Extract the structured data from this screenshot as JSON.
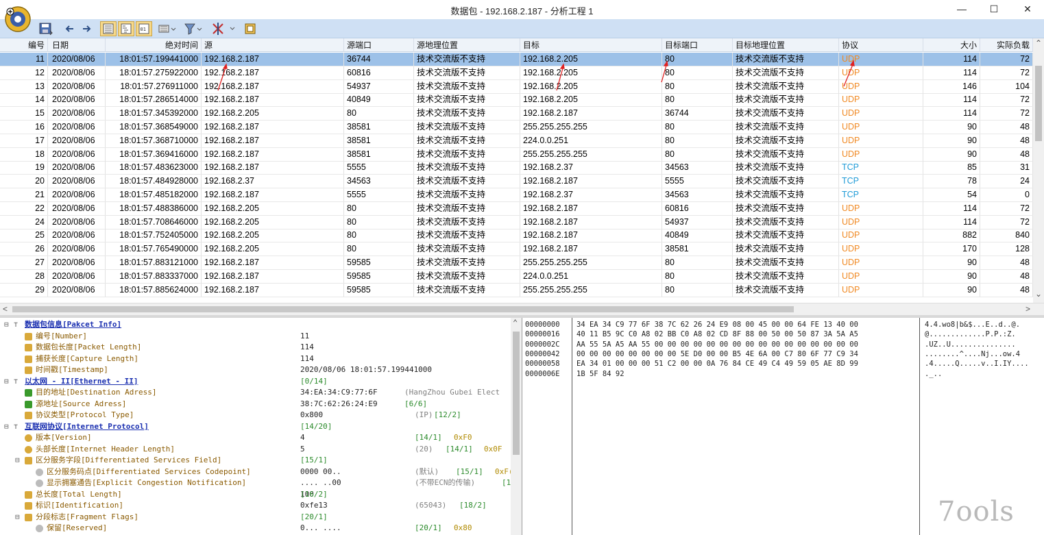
{
  "window": {
    "title": "数据包 - 192.168.2.187 - 分析工程 1",
    "minimize": "—",
    "maximize": "☐",
    "close": "✕"
  },
  "toolbar": {
    "icons": [
      "save-icon",
      "back-icon",
      "forward-icon",
      "view-list-icon",
      "view-detail-icon",
      "view-hex-icon",
      "filter-icon",
      "funnel-icon",
      "tools-icon",
      "export-icon"
    ]
  },
  "columns": [
    "编号",
    "日期",
    "绝对时间",
    "源",
    "源端口",
    "源地理位置",
    "目标",
    "目标端口",
    "目标地理位置",
    "协议",
    "大小",
    "实际负载"
  ],
  "packets": [
    {
      "no": "11",
      "date": "2020/08/06",
      "time": "18:01:57.199441000",
      "src": "192.168.2.187",
      "sport": "36744",
      "sgeo": "技术交流版不支持",
      "dst": "192.168.2.205",
      "dport": "80",
      "dgeo": "技术交流版不支持",
      "proto": "UDP",
      "size": "114",
      "payload": "72",
      "selected": true
    },
    {
      "no": "12",
      "date": "2020/08/06",
      "time": "18:01:57.275922000",
      "src": "192.168.2.187",
      "sport": "60816",
      "sgeo": "技术交流版不支持",
      "dst": "192.168.2.205",
      "dport": "80",
      "dgeo": "技术交流版不支持",
      "proto": "UDP",
      "size": "114",
      "payload": "72"
    },
    {
      "no": "13",
      "date": "2020/08/06",
      "time": "18:01:57.276911000",
      "src": "192.168.2.187",
      "sport": "54937",
      "sgeo": "技术交流版不支持",
      "dst": "192.168.2.205",
      "dport": "80",
      "dgeo": "技术交流版不支持",
      "proto": "UDP",
      "size": "146",
      "payload": "104"
    },
    {
      "no": "14",
      "date": "2020/08/06",
      "time": "18:01:57.286514000",
      "src": "192.168.2.187",
      "sport": "40849",
      "sgeo": "技术交流版不支持",
      "dst": "192.168.2.205",
      "dport": "80",
      "dgeo": "技术交流版不支持",
      "proto": "UDP",
      "size": "114",
      "payload": "72"
    },
    {
      "no": "15",
      "date": "2020/08/06",
      "time": "18:01:57.345392000",
      "src": "192.168.2.205",
      "sport": "80",
      "sgeo": "技术交流版不支持",
      "dst": "192.168.2.187",
      "dport": "36744",
      "dgeo": "技术交流版不支持",
      "proto": "UDP",
      "size": "114",
      "payload": "72"
    },
    {
      "no": "16",
      "date": "2020/08/06",
      "time": "18:01:57.368549000",
      "src": "192.168.2.187",
      "sport": "38581",
      "sgeo": "技术交流版不支持",
      "dst": "255.255.255.255",
      "dport": "80",
      "dgeo": "技术交流版不支持",
      "proto": "UDP",
      "size": "90",
      "payload": "48"
    },
    {
      "no": "17",
      "date": "2020/08/06",
      "time": "18:01:57.368710000",
      "src": "192.168.2.187",
      "sport": "38581",
      "sgeo": "技术交流版不支持",
      "dst": "224.0.0.251",
      "dport": "80",
      "dgeo": "技术交流版不支持",
      "proto": "UDP",
      "size": "90",
      "payload": "48"
    },
    {
      "no": "18",
      "date": "2020/08/06",
      "time": "18:01:57.369416000",
      "src": "192.168.2.187",
      "sport": "38581",
      "sgeo": "技术交流版不支持",
      "dst": "255.255.255.255",
      "dport": "80",
      "dgeo": "技术交流版不支持",
      "proto": "UDP",
      "size": "90",
      "payload": "48"
    },
    {
      "no": "19",
      "date": "2020/08/06",
      "time": "18:01:57.483623000",
      "src": "192.168.2.187",
      "sport": "5555",
      "sgeo": "技术交流版不支持",
      "dst": "192.168.2.37",
      "dport": "34563",
      "dgeo": "技术交流版不支持",
      "proto": "TCP",
      "size": "85",
      "payload": "31"
    },
    {
      "no": "20",
      "date": "2020/08/06",
      "time": "18:01:57.484928000",
      "src": "192.168.2.37",
      "sport": "34563",
      "sgeo": "技术交流版不支持",
      "dst": "192.168.2.187",
      "dport": "5555",
      "dgeo": "技术交流版不支持",
      "proto": "TCP",
      "size": "78",
      "payload": "24"
    },
    {
      "no": "21",
      "date": "2020/08/06",
      "time": "18:01:57.485182000",
      "src": "192.168.2.187",
      "sport": "5555",
      "sgeo": "技术交流版不支持",
      "dst": "192.168.2.37",
      "dport": "34563",
      "dgeo": "技术交流版不支持",
      "proto": "TCP",
      "size": "54",
      "payload": "0"
    },
    {
      "no": "22",
      "date": "2020/08/06",
      "time": "18:01:57.488386000",
      "src": "192.168.2.205",
      "sport": "80",
      "sgeo": "技术交流版不支持",
      "dst": "192.168.2.187",
      "dport": "60816",
      "dgeo": "技术交流版不支持",
      "proto": "UDP",
      "size": "114",
      "payload": "72"
    },
    {
      "no": "24",
      "date": "2020/08/06",
      "time": "18:01:57.708646000",
      "src": "192.168.2.205",
      "sport": "80",
      "sgeo": "技术交流版不支持",
      "dst": "192.168.2.187",
      "dport": "54937",
      "dgeo": "技术交流版不支持",
      "proto": "UDP",
      "size": "114",
      "payload": "72"
    },
    {
      "no": "25",
      "date": "2020/08/06",
      "time": "18:01:57.752405000",
      "src": "192.168.2.205",
      "sport": "80",
      "sgeo": "技术交流版不支持",
      "dst": "192.168.2.187",
      "dport": "40849",
      "dgeo": "技术交流版不支持",
      "proto": "UDP",
      "size": "882",
      "payload": "840"
    },
    {
      "no": "26",
      "date": "2020/08/06",
      "time": "18:01:57.765490000",
      "src": "192.168.2.205",
      "sport": "80",
      "sgeo": "技术交流版不支持",
      "dst": "192.168.2.187",
      "dport": "38581",
      "dgeo": "技术交流版不支持",
      "proto": "UDP",
      "size": "170",
      "payload": "128"
    },
    {
      "no": "27",
      "date": "2020/08/06",
      "time": "18:01:57.883121000",
      "src": "192.168.2.187",
      "sport": "59585",
      "sgeo": "技术交流版不支持",
      "dst": "255.255.255.255",
      "dport": "80",
      "dgeo": "技术交流版不支持",
      "proto": "UDP",
      "size": "90",
      "payload": "48"
    },
    {
      "no": "28",
      "date": "2020/08/06",
      "time": "18:01:57.883337000",
      "src": "192.168.2.187",
      "sport": "59585",
      "sgeo": "技术交流版不支持",
      "dst": "224.0.0.251",
      "dport": "80",
      "dgeo": "技术交流版不支持",
      "proto": "UDP",
      "size": "90",
      "payload": "48"
    },
    {
      "no": "29",
      "date": "2020/08/06",
      "time": "18:01:57.885624000",
      "src": "192.168.2.187",
      "sport": "59585",
      "sgeo": "技术交流版不支持",
      "dst": "255.255.255.255",
      "dport": "80",
      "dgeo": "技术交流版不支持",
      "proto": "UDP",
      "size": "90",
      "payload": "48"
    }
  ],
  "tree": [
    {
      "indent": 0,
      "sec": true,
      "label": "数据包信息[Pakcet Info]",
      "value": "",
      "ex1": "",
      "ex2": "",
      "ex3": ""
    },
    {
      "indent": 1,
      "label": "编号[Number]",
      "value": "11",
      "ex1": "",
      "ex2": "",
      "ex3": ""
    },
    {
      "indent": 1,
      "label": "数据包长度[Packet Length]",
      "value": "114",
      "ex1": "",
      "ex2": "",
      "ex3": ""
    },
    {
      "indent": 1,
      "label": "捕获长度[Capture Length]",
      "value": "114",
      "ex1": "",
      "ex2": "",
      "ex3": ""
    },
    {
      "indent": 1,
      "label": "时间戳[Timestamp]",
      "value": "2020/08/06 18:01:57.199441000",
      "ex1": "",
      "ex2": "",
      "ex3": ""
    },
    {
      "indent": 0,
      "sec": true,
      "label": "以太网 - II[Ethernet - II]",
      "value": "",
      "ex1": "",
      "ex2": "[0/14]",
      "ex3": ""
    },
    {
      "indent": 1,
      "label": "目的地址[Destination Adress]",
      "value": "34:EA:34:C9:77:6F",
      "ex1": "(HangZhou Gubei Elect",
      "ex2": "",
      "ex3": ""
    },
    {
      "indent": 1,
      "label": "源地址[Source Adress]",
      "value": "38:7C:62:26:24:E9",
      "ex1": "",
      "ex2": "[6/6]",
      "ex3": ""
    },
    {
      "indent": 1,
      "label": "协议类型[Protocol Type]",
      "value": "0x800",
      "ex1": "(IP)",
      "ex2": "[12/2]",
      "ex3": ""
    },
    {
      "indent": 0,
      "sec": true,
      "label": "互联网协议[Internet Protocol]",
      "value": "",
      "ex1": "",
      "ex2": "[14/20]",
      "ex3": ""
    },
    {
      "indent": 1,
      "label": "版本[Version]",
      "value": "4",
      "ex1": "",
      "ex2": "[14/1]",
      "ex3": "0xF0"
    },
    {
      "indent": 1,
      "label": "头部长度[Internet Header Length]",
      "value": "5",
      "ex1": "(20)",
      "ex2": "[14/1]",
      "ex3": "0x0F"
    },
    {
      "indent": 1,
      "label": "区分服务字段[Differentiated Services Field]",
      "value": "",
      "ex1": "",
      "ex2": "[15/1]",
      "ex3": ""
    },
    {
      "indent": 2,
      "label": "区分服务码点[Differentiated Services Codepoint]",
      "value": "0000 00..",
      "ex1": "(默认)",
      "ex2": "[15/1]",
      "ex3": "0xF("
    },
    {
      "indent": 2,
      "label": "显示拥塞通告[Explicit Congestion Notification]",
      "value": ".... ..00",
      "ex1": "(不带ECN的传输)",
      "ex2": "[1",
      "ex3": ""
    },
    {
      "indent": 1,
      "label": "总长度[Total Length]",
      "value": "100",
      "ex1": "",
      "ex2": "[16/2]",
      "ex3": ""
    },
    {
      "indent": 1,
      "label": "标识[Identification]",
      "value": "0xfe13",
      "ex1": "(65043)",
      "ex2": "[18/2]",
      "ex3": ""
    },
    {
      "indent": 1,
      "label": "分段标志[Fragment Flags]",
      "value": "",
      "ex1": "",
      "ex2": "[20/1]",
      "ex3": ""
    },
    {
      "indent": 2,
      "label": "保留[Reserved]",
      "value": "0... ....",
      "ex1": "",
      "ex2": "[20/1]",
      "ex3": "0x80"
    }
  ],
  "hex": {
    "offsets": [
      "00000000",
      "00000016",
      "0000002C",
      "00000042",
      "00000058",
      "0000006E"
    ],
    "bytes": [
      "34 EA 34 C9 77 6F 38 7C 62 26 24 E9 08 00 45 00 00 64 FE 13 40 00",
      "40 11 B5 9C C0 A8 02 BB C0 A8 02 CD 8F 88 00 50 00 50 87 3A 5A A5",
      "AA 55 5A A5 AA 55 00 00 00 00 00 00 00 00 00 00 00 00 00 00 00 00",
      "00 00 00 00 00 00 00 00 5E D0 00 00 B5 4E 6A 00 C7 80 6F 77 C9 34",
      "EA 34 01 00 00 00 51 C2 00 00 0A 76 84 CE 49 C4 49 59 05 AE 8D 99",
      "1B 5F 84 92"
    ],
    "ascii": [
      "4.4.wo8|b&$...E..d..@.",
      "@.............P.P.:Z.",
      ".UZ..U...............",
      "........^....Nj...ow.4",
      ".4.....Q.....v..I.IY....",
      "._.."
    ]
  },
  "watermark": "7ools",
  "colors": {
    "udp": "#f08a24",
    "tcp": "#1f9bd7",
    "selected_row": "#9dc1e8",
    "toolbar": "#cfe0f4",
    "section_label": "#1a2fb0"
  }
}
